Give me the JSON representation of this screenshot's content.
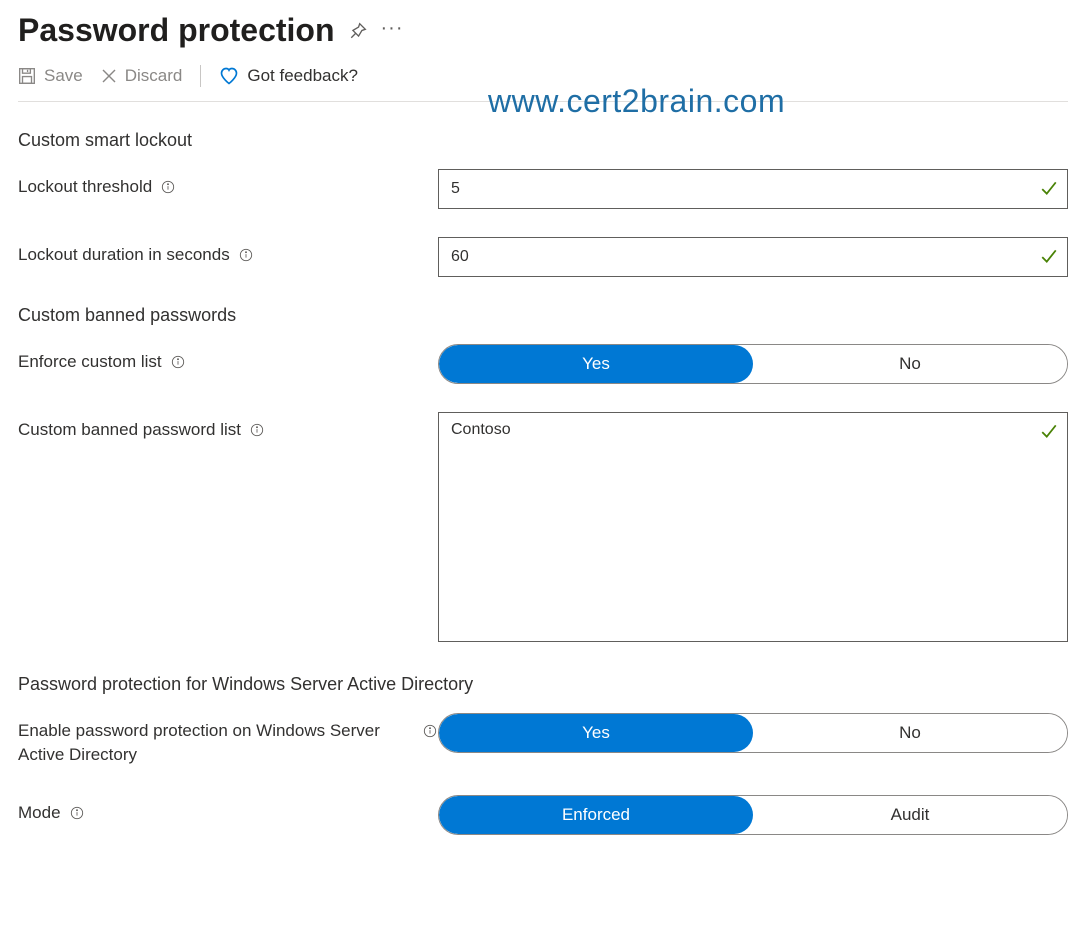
{
  "header": {
    "title": "Password protection"
  },
  "toolbar": {
    "save_label": "Save",
    "discard_label": "Discard",
    "feedback_label": "Got feedback?"
  },
  "watermark": "www.cert2brain.com",
  "sections": {
    "lockout_title": "Custom smart lockout",
    "banned_title": "Custom banned passwords",
    "ad_title": "Password protection for Windows Server Active Directory"
  },
  "fields": {
    "lockout_threshold": {
      "label": "Lockout threshold",
      "value": "5"
    },
    "lockout_duration": {
      "label": "Lockout duration in seconds",
      "value": "60"
    },
    "enforce_custom_list": {
      "label": "Enforce custom list",
      "options": [
        "Yes",
        "No"
      ],
      "selected": "Yes"
    },
    "banned_list": {
      "label": "Custom banned password list",
      "value": "Contoso"
    },
    "enable_ad": {
      "label": "Enable password protection on Windows Server Active Directory",
      "options": [
        "Yes",
        "No"
      ],
      "selected": "Yes"
    },
    "mode": {
      "label": "Mode",
      "options": [
        "Enforced",
        "Audit"
      ],
      "selected": "Enforced"
    }
  }
}
